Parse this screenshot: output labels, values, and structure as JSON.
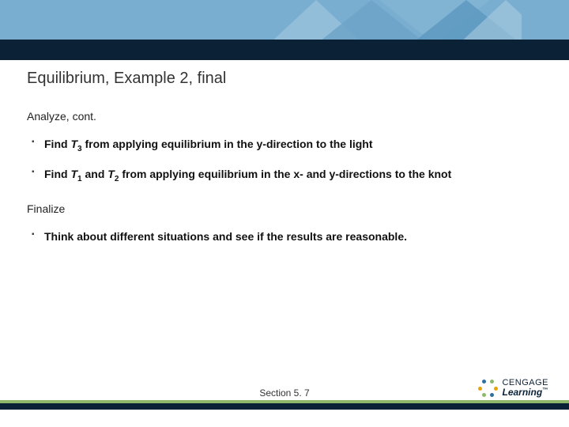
{
  "slide": {
    "title": "Equilibrium, Example 2, final",
    "analyze_label": "Analyze, cont.",
    "analyze_items": [
      {
        "pre": "Find ",
        "var": "T",
        "sub": "3",
        "post": " from applying equilibrium in the y-direction to the light"
      },
      {
        "pre": "Find ",
        "var": "T",
        "sub": "1",
        "mid": " and ",
        "var2": "T",
        "sub2": "2",
        "post": " from applying equilibrium in the x- and y-directions to the knot"
      }
    ],
    "finalize_label": "Finalize",
    "finalize_items": [
      {
        "text": "Think about different situations and see if the results are reasonable."
      }
    ],
    "section": "Section 5. 7"
  },
  "brand": {
    "line1": "CENGAGE",
    "line2": "Learning",
    "tm": "™"
  },
  "colors": {
    "banner": "#7aaed0",
    "darkbar": "#0b2135",
    "accent_green": "#8fb96a"
  }
}
